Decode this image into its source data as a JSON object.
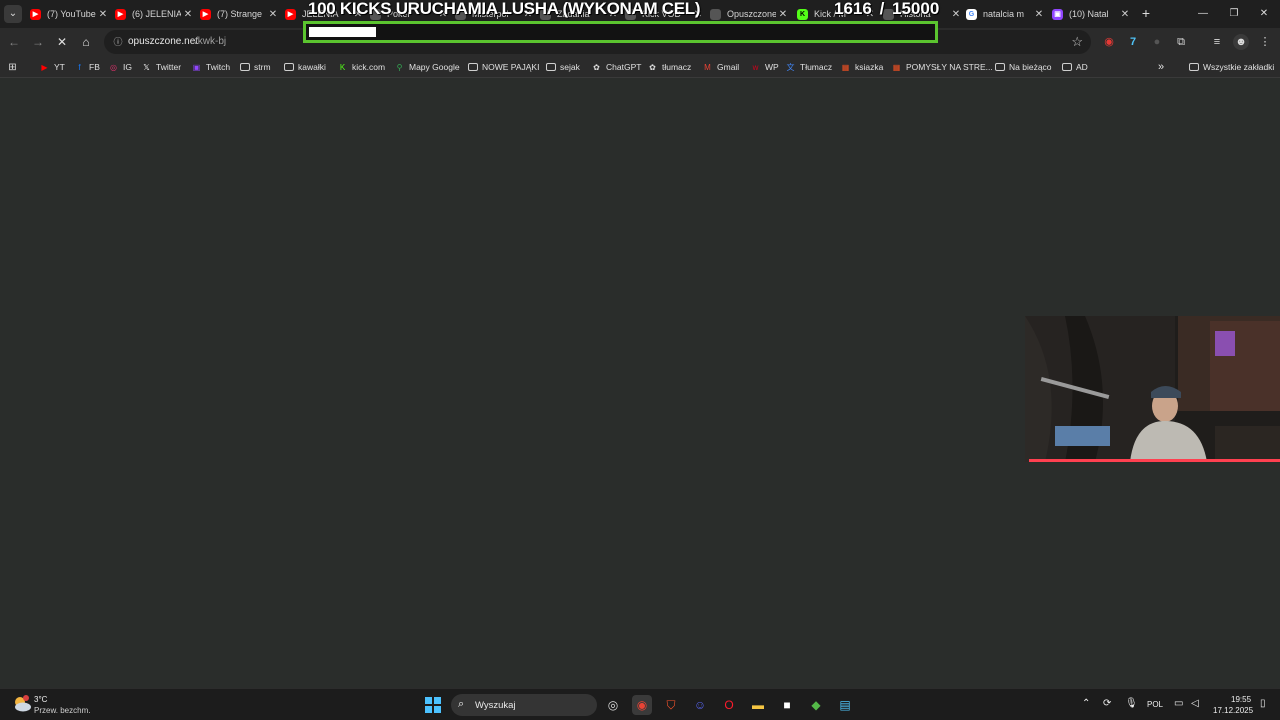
{
  "overlay": {
    "goal_title": "100 KICKS URUCHAMIA LUSHA (WYKONAM CEL)",
    "goal_current": "1616",
    "goal_target": "/ 15000",
    "progress": 0.108
  },
  "tabs": [
    {
      "title": "(7) YouTube",
      "icon": "youtube-icon",
      "color": "#ff0000"
    },
    {
      "title": "(6) JELENIA",
      "icon": "youtube-icon",
      "color": "#ff0000"
    },
    {
      "title": "(7) Strange",
      "icon": "youtube-icon",
      "color": "#ff0000"
    },
    {
      "title": "JELENIA",
      "icon": "youtube-icon",
      "color": "#ff0000"
    },
    {
      "title": "Poker",
      "icon": "page-icon",
      "color": "#555"
    },
    {
      "title": "Misterpol",
      "icon": "page-icon",
      "color": "#555"
    },
    {
      "title": "Zadania",
      "icon": "page-icon",
      "color": "#555"
    },
    {
      "title": "Kick VOD",
      "icon": "page-icon",
      "color": "#555"
    },
    {
      "title": "Opuszczone",
      "icon": "loading-icon",
      "color": "#555"
    },
    {
      "title": "Kick / M",
      "icon": "kick-icon",
      "color": "#53fc18"
    },
    {
      "title": "Historia",
      "icon": "page-icon",
      "color": "#555"
    },
    {
      "title": "natalcia m",
      "icon": "google-icon",
      "color": "#ffffff"
    },
    {
      "title": "(10) Natal",
      "icon": "twitch-icon",
      "color": "#9146ff"
    }
  ],
  "address": {
    "host": "opuszczone.net",
    "path": "/kwk-bj"
  },
  "bookmarks": [
    {
      "label": "YT",
      "icon": "youtube-icon",
      "color": "#ff0000"
    },
    {
      "label": "FB",
      "icon": "facebook-icon",
      "color": "#1877f2"
    },
    {
      "label": "IG",
      "icon": "instagram-icon",
      "color": "#e1306c"
    },
    {
      "label": "Twitter",
      "icon": "x-icon",
      "color": "#ffffff"
    },
    {
      "label": "Twitch",
      "icon": "twitch-icon",
      "color": "#9146ff"
    },
    {
      "label": "strm",
      "icon": "folder-icon",
      "color": "#cfcfcf"
    },
    {
      "label": "kawałki",
      "icon": "folder-icon",
      "color": "#cfcfcf"
    },
    {
      "label": "kick.com",
      "icon": "kick-icon",
      "color": "#53fc18"
    },
    {
      "label": "Mapy Google",
      "icon": "maps-icon",
      "color": "#34a853"
    },
    {
      "label": "NOWE PAJĄKI",
      "icon": "folder-icon",
      "color": "#cfcfcf"
    },
    {
      "label": "sejak",
      "icon": "folder-icon",
      "color": "#cfcfcf"
    },
    {
      "label": "ChatGPT",
      "icon": "chatgpt-icon",
      "color": "#e0e0e0"
    },
    {
      "label": "tłumacz",
      "icon": "chatgpt-icon",
      "color": "#e0e0e0"
    },
    {
      "label": "Gmail",
      "icon": "gmail-icon",
      "color": "#ea4335"
    },
    {
      "label": "WP",
      "icon": "wp-icon",
      "color": "#d0021b"
    },
    {
      "label": "Tłumacz",
      "icon": "translate-icon",
      "color": "#4285f4"
    },
    {
      "label": "ksiazka",
      "icon": "microsoft-icon",
      "color": "#f25022"
    },
    {
      "label": "POMYSŁY NA STRE...",
      "icon": "microsoft-icon",
      "color": "#f25022"
    },
    {
      "label": "Na bieżąco",
      "icon": "folder-icon",
      "color": "#cfcfcf"
    },
    {
      "label": "AD",
      "icon": "folder-icon",
      "color": "#cfcfcf"
    }
  ],
  "all_bookmarks": "Wszystkie zakładki",
  "taskbar": {
    "temp": "3°C",
    "weather": "Przew. bezchm.",
    "search_placeholder": "Wyszukaj",
    "lang": "POL",
    "time": "19:55",
    "date": "17.12.2025"
  }
}
